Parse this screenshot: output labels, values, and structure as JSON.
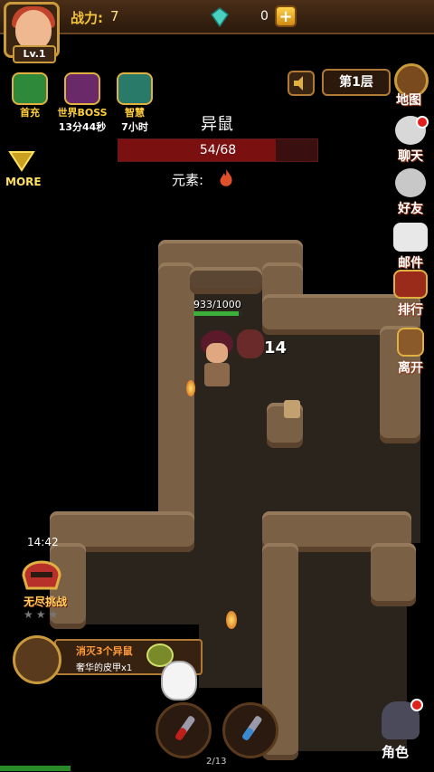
{
  "header": {
    "level": "Lv.1",
    "power_label": "战力:",
    "power_value": "7",
    "gems": "0",
    "plus": "+"
  },
  "floor": "第1层",
  "events": [
    {
      "label": "首充",
      "icon": "gift-icon"
    },
    {
      "label": "世界BOSS",
      "sub": "13分44秒",
      "icon": "boss-skull-icon"
    },
    {
      "label": "智慧",
      "sub": "7小时",
      "icon": "puzzle-icon"
    }
  ],
  "more": "MORE",
  "enemy": {
    "name": "异鼠",
    "hp_text": "54/68",
    "hp_fraction": 0.79,
    "element_label": "元素:",
    "element_icon": "fire-icon"
  },
  "side_menu": [
    {
      "label": "地图",
      "icon": "map-icon"
    },
    {
      "label": "聊天",
      "icon": "chat-icon",
      "badge": true
    },
    {
      "label": "好友",
      "icon": "friends-icon"
    },
    {
      "label": "邮件",
      "icon": "mail-icon"
    },
    {
      "label": "排行",
      "icon": "ranking-icon"
    },
    {
      "label": "离开",
      "icon": "exit-door-icon"
    }
  ],
  "battle": {
    "player_hp": "933/1000",
    "damage": "14"
  },
  "challenge": {
    "timer": "14:42",
    "label": "无尽挑战",
    "stars": 0
  },
  "quest": {
    "title": "消灭3个异鼠",
    "reward": "奢华的皮甲x1"
  },
  "bottom": {
    "page": "2/13",
    "role_label": "角色"
  }
}
